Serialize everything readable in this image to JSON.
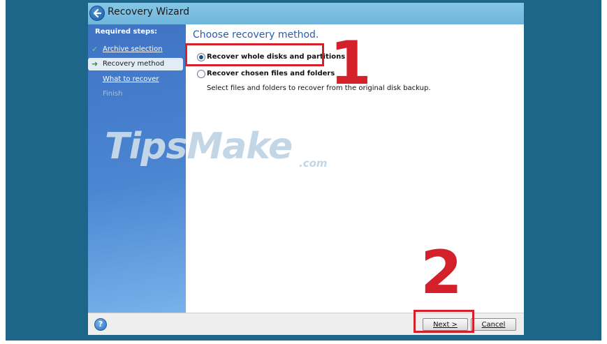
{
  "window": {
    "title": "Recovery Wizard"
  },
  "sidebar": {
    "title": "Required steps:",
    "steps": [
      {
        "label": "Archive selection",
        "state": "done"
      },
      {
        "label": "Recovery method",
        "state": "current"
      },
      {
        "label": "What to recover",
        "state": "pending"
      },
      {
        "label": "Finish",
        "state": "disabled"
      }
    ]
  },
  "main": {
    "heading": "Choose recovery method.",
    "options": [
      {
        "label": "Recover whole disks and partitions",
        "selected": true
      },
      {
        "label": "Recover chosen files and folders",
        "selected": false
      }
    ],
    "description": "Select files and folders to recover from the original disk backup."
  },
  "footer": {
    "help_icon": "help-icon",
    "next_label": "Next >",
    "cancel_label": "Cancel"
  },
  "annotations": {
    "marker_1": "1",
    "marker_2": "2",
    "color": "#d4202a"
  },
  "watermark": {
    "main": "TipsMake",
    "suffix": ".com"
  },
  "colors": {
    "desktop": "#1d6689",
    "titlebar": "#86c6e6",
    "sidebar": "#4b86d2",
    "heading": "#2b5ea7"
  }
}
